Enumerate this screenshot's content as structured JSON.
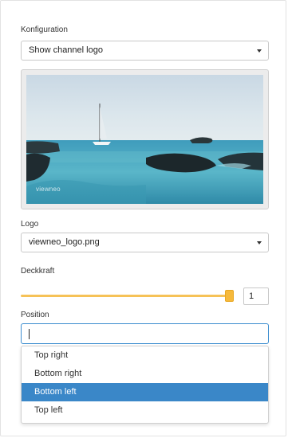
{
  "config": {
    "label": "Konfiguration",
    "selected": "Show channel logo"
  },
  "preview": {
    "watermark": "viewneo"
  },
  "logo": {
    "label": "Logo",
    "selected": "viewneo_logo.png"
  },
  "opacity": {
    "label": "Deckkraft",
    "value": "1",
    "slider_fraction": 1
  },
  "position": {
    "label": "Position",
    "input_value": "",
    "options": [
      "Top right",
      "Bottom right",
      "Bottom left",
      "Top left"
    ],
    "highlighted": "Bottom left"
  },
  "colors": {
    "accent_blue": "#3a87c8",
    "slider": "#f6c257",
    "focus_border": "#3c8dcf"
  }
}
